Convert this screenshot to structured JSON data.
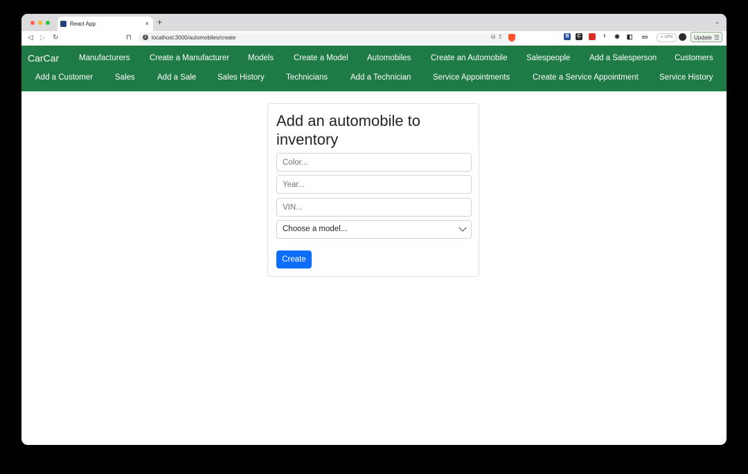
{
  "browser": {
    "tab_title": "React App",
    "tab_close": "×",
    "new_tab": "+",
    "url": "localhost:3000/automobiles/create",
    "vpn_label": "VPN",
    "update_label": "Update",
    "extensions": [
      {
        "name": "ext-b-icon",
        "label": "B",
        "color": "#2a4fa0"
      },
      {
        "name": "ext-c-icon",
        "label": "C",
        "color": "#2b2b2b"
      },
      {
        "name": "ext-red-icon",
        "label": "",
        "color": "#d93025"
      },
      {
        "name": "ext-i-icon",
        "label": "I",
        "color": "#ffffff"
      }
    ]
  },
  "nav": {
    "brand": "CarCar",
    "row1": [
      "Manufacturers",
      "Create a Manufacturer",
      "Models",
      "Create a Model",
      "Automobiles",
      "Create an Automobile",
      "Salespeople",
      "Add a Salesperson",
      "Customers"
    ],
    "row2": [
      "Add a Customer",
      "Sales",
      "Add a Sale",
      "Sales History",
      "Technicians",
      "Add a Technician",
      "Service Appointments",
      "Create a Service Appointment",
      "Service History"
    ]
  },
  "form": {
    "title": "Add an automobile to inventory",
    "color_placeholder": "Color...",
    "year_placeholder": "Year...",
    "vin_placeholder": "VIN...",
    "model_select_value": "Choose a model...",
    "submit_label": "Create"
  },
  "colors": {
    "navbar_bg": "#1e7b45",
    "primary_button": "#0d6efd"
  }
}
